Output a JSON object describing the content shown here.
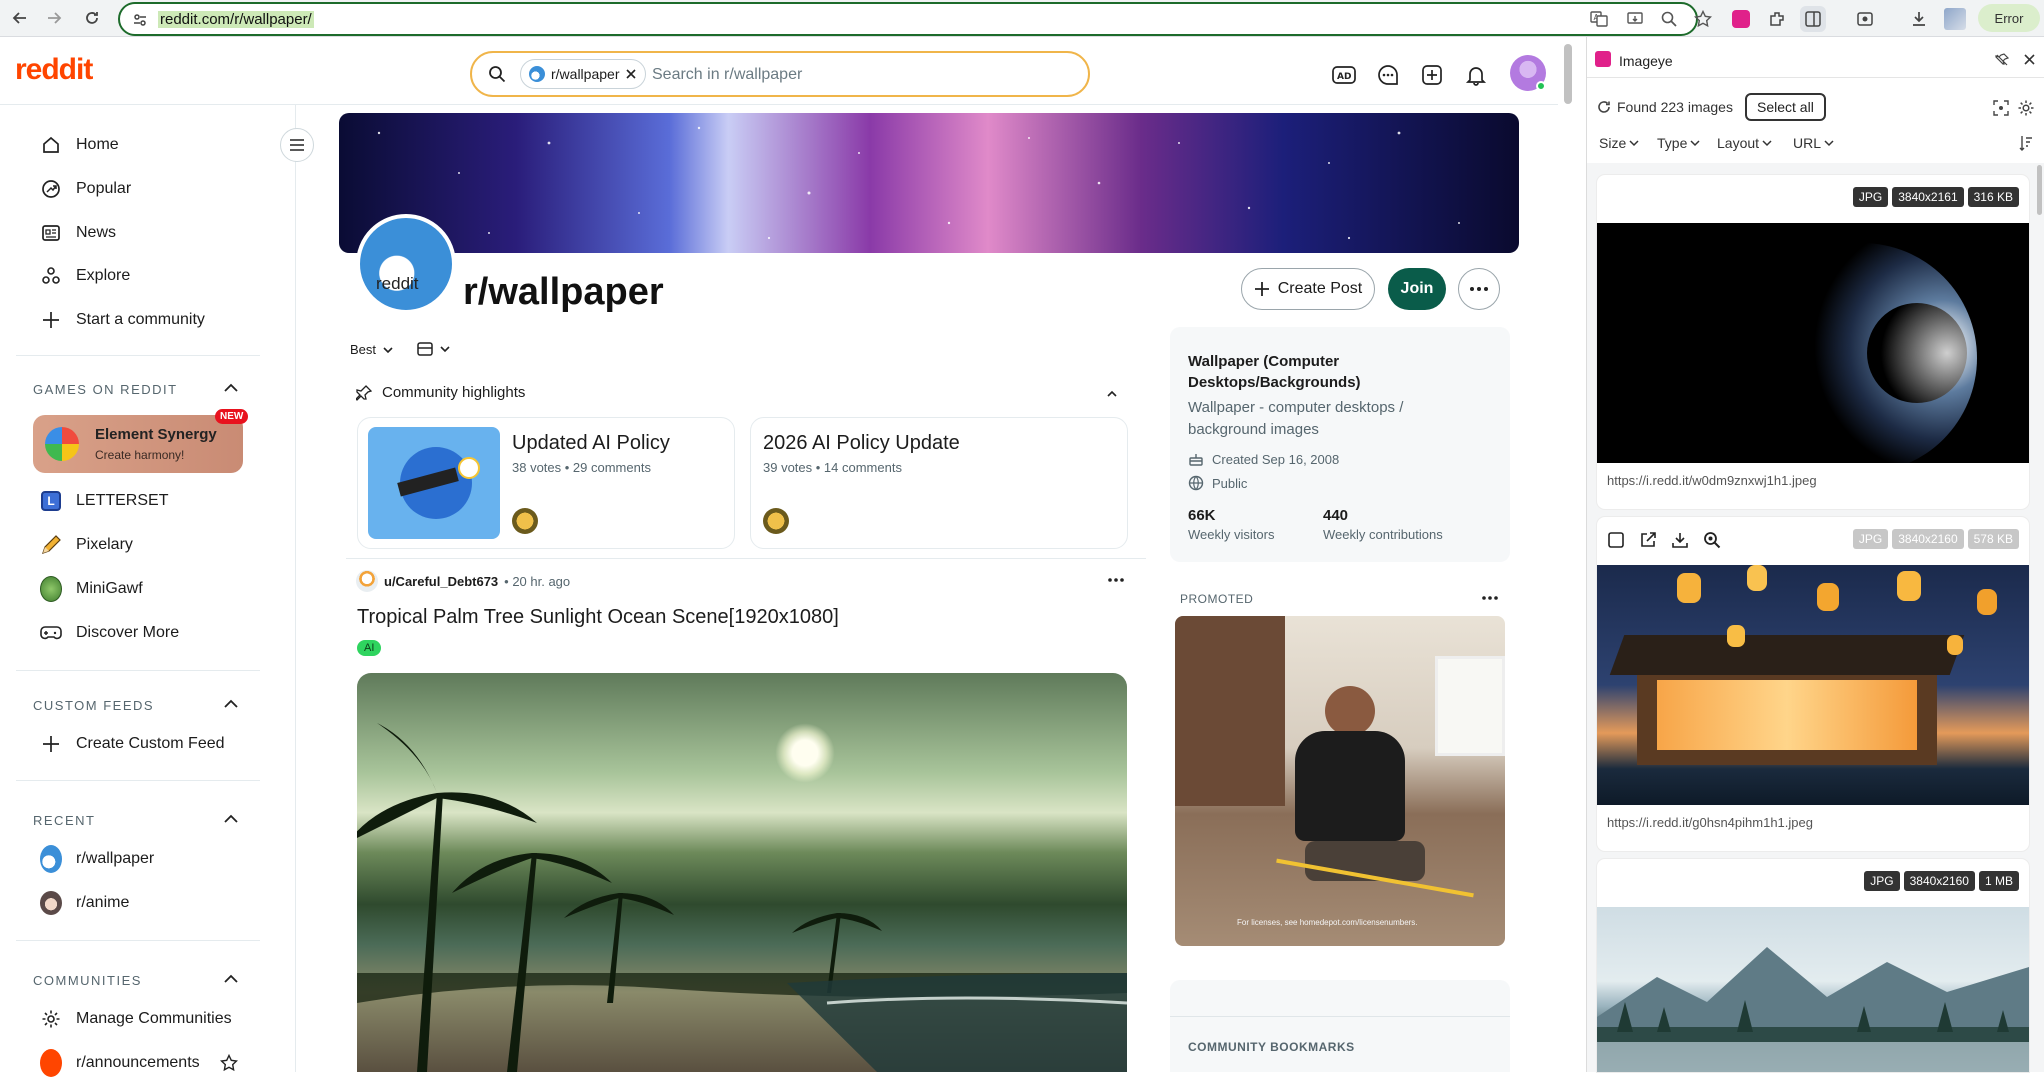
{
  "browser": {
    "url": "reddit.com/r/wallpaper/",
    "error_label": "Error"
  },
  "header": {
    "logo": "reddit",
    "search_chip": "r/wallpaper",
    "search_placeholder": "Search in r/wallpaper"
  },
  "sidebar": {
    "nav": [
      {
        "label": "Home",
        "icon": "home-icon"
      },
      {
        "label": "Popular",
        "icon": "popular-icon"
      },
      {
        "label": "News",
        "icon": "news-icon"
      },
      {
        "label": "Explore",
        "icon": "explore-icon"
      },
      {
        "label": "Start a community",
        "icon": "plus-icon"
      }
    ],
    "games_heading": "GAMES ON REDDIT",
    "featured_game": {
      "title": "Element Synergy",
      "subtitle": "Create harmony!",
      "badge": "NEW"
    },
    "games": [
      {
        "label": "LETTERSET"
      },
      {
        "label": "Pixelary"
      },
      {
        "label": "MiniGawf"
      },
      {
        "label": "Discover More"
      }
    ],
    "custom_feeds_heading": "CUSTOM FEEDS",
    "create_custom_feed": "Create Custom Feed",
    "recent_heading": "RECENT",
    "recent": [
      {
        "label": "r/wallpaper"
      },
      {
        "label": "r/anime"
      }
    ],
    "communities_heading": "COMMUNITIES",
    "manage_communities": "Manage Communities",
    "announcements": "r/announcements"
  },
  "subreddit": {
    "name": "r/wallpaper",
    "avatar_text": "reddit",
    "create_post": "Create Post",
    "join": "Join",
    "sort": "Best"
  },
  "highlights": {
    "heading": "Community highlights",
    "cards": [
      {
        "title": "Updated AI Policy",
        "meta": "38 votes • 29 comments"
      },
      {
        "title": "2026 AI Policy Update",
        "meta": "39 votes • 14 comments"
      }
    ]
  },
  "post": {
    "author": "u/Careful_Debt673",
    "time": "• 20 hr. ago",
    "title": "Tropical Palm Tree Sunlight Ocean Scene[1920x1080]",
    "flair": "AI"
  },
  "about": {
    "title": "Wallpaper (Computer Desktops/Backgrounds)",
    "description": "Wallpaper - computer desktops / background images",
    "created": "Created Sep 16, 2008",
    "visibility": "Public",
    "stats": [
      {
        "value": "66K",
        "label": "Weekly visitors"
      },
      {
        "value": "440",
        "label": "Weekly contributions"
      }
    ]
  },
  "promoted": {
    "label": "PROMOTED",
    "ad_caption": "For licenses, see homedepot.com/licensenumbers."
  },
  "bookmarks": {
    "heading": "COMMUNITY BOOKMARKS"
  },
  "imageye": {
    "title": "Imageye",
    "found": "Found 223 images",
    "select_all": "Select all",
    "filters": [
      "Size",
      "Type",
      "Layout",
      "URL"
    ],
    "images": [
      {
        "type": "JPG",
        "dims": "3840x2161",
        "size": "316 KB",
        "url": "https://i.redd.it/w0dm9znxwj1h1.jpeg"
      },
      {
        "type": "JPG",
        "dims": "3840x2160",
        "size": "578 KB",
        "url": "https://i.redd.it/g0hsn4pihm1h1.jpeg"
      },
      {
        "type": "JPG",
        "dims": "3840x2160",
        "size": "1 MB",
        "url": ""
      }
    ]
  },
  "colors": {
    "reddit_orange": "#ff4500",
    "join_green": "#0a5c4a",
    "imageye_pink": "#e0218a",
    "url_border": "#1d6b2b"
  }
}
